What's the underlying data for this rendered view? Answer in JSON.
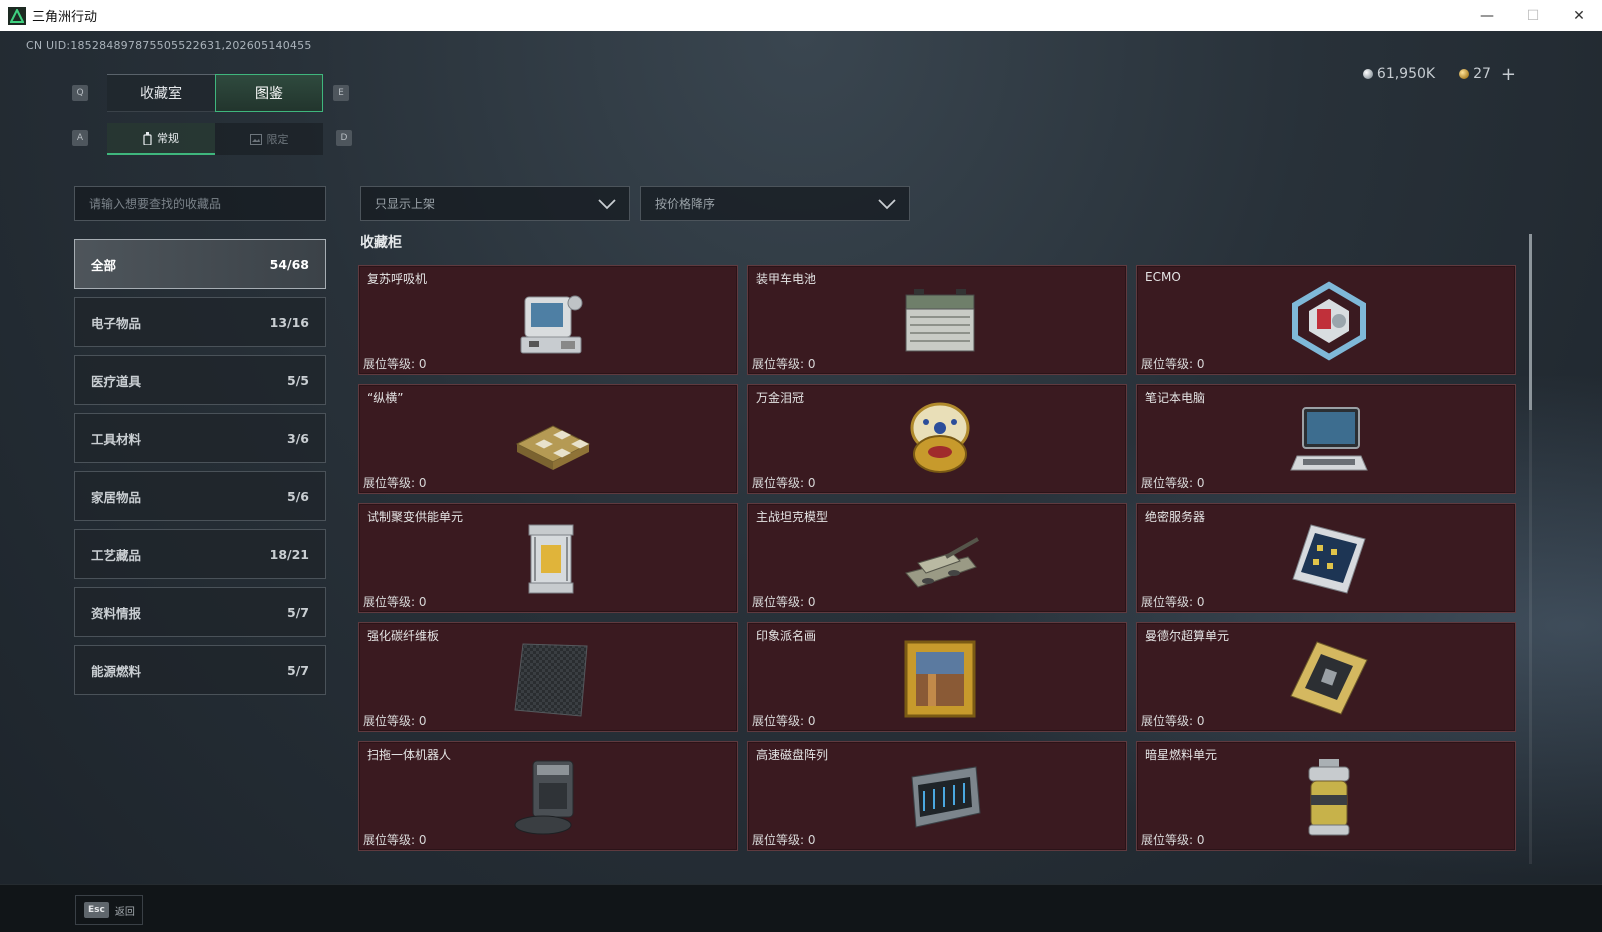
{
  "window": {
    "title": "三角洲行动",
    "minimize": "—",
    "maximize": "☐",
    "close": "✕"
  },
  "uid": "CN UID:18528489787550552263​1,202605140455",
  "currency": {
    "coins": "61,950K",
    "tokens": "27",
    "add": "+"
  },
  "keys": {
    "prev_tab": "Q",
    "next_tab": "E",
    "prev_sub": "A",
    "next_sub": "D"
  },
  "tabs": [
    {
      "label": "收藏室"
    },
    {
      "label": "图鉴"
    }
  ],
  "subtabs": [
    {
      "label": "常规"
    },
    {
      "label": "限定"
    }
  ],
  "search": {
    "placeholder": "请输入想要查找的收藏品"
  },
  "filter": {
    "value": "只显示上架"
  },
  "sort": {
    "value": "按价格降序"
  },
  "categories": [
    {
      "label": "全部",
      "count": "54/68"
    },
    {
      "label": "电子物品",
      "count": "13/16"
    },
    {
      "label": "医疗道具",
      "count": "5/5"
    },
    {
      "label": "工具材料",
      "count": "3/6"
    },
    {
      "label": "家居物品",
      "count": "5/6"
    },
    {
      "label": "工艺藏品",
      "count": "18/21"
    },
    {
      "label": "资料情报",
      "count": "5/7"
    },
    {
      "label": "能源燃料",
      "count": "5/7"
    }
  ],
  "section_title": "收藏柜",
  "level_label": "展位等级:  0",
  "items": [
    {
      "name": "复苏呼吸机",
      "icon": "ventilator-icon"
    },
    {
      "name": "装甲车电池",
      "icon": "battery-icon"
    },
    {
      "name": "ECMO",
      "icon": "ecmo-icon"
    },
    {
      "name": "“纵横”",
      "icon": "chessboard-icon"
    },
    {
      "name": "万金泪冠",
      "icon": "jeweled-egg-icon"
    },
    {
      "name": "笔记本电脑",
      "icon": "laptop-icon"
    },
    {
      "name": "试制聚变供能单元",
      "icon": "fusion-unit-icon"
    },
    {
      "name": "主战坦克模型",
      "icon": "tank-model-icon"
    },
    {
      "name": "绝密服务器",
      "icon": "server-icon"
    },
    {
      "name": "强化碳纤维板",
      "icon": "carbon-plate-icon"
    },
    {
      "name": "印象派名画",
      "icon": "painting-icon"
    },
    {
      "name": "曼德尔超算单元",
      "icon": "cpu-icon"
    },
    {
      "name": "扫拖一体机器人",
      "icon": "robot-vacuum-icon"
    },
    {
      "name": "高速磁盘阵列",
      "icon": "disk-array-icon"
    },
    {
      "name": "暗星燃料单元",
      "icon": "fuel-canister-icon"
    }
  ],
  "footer": {
    "key": "Esc",
    "label": "返回"
  }
}
